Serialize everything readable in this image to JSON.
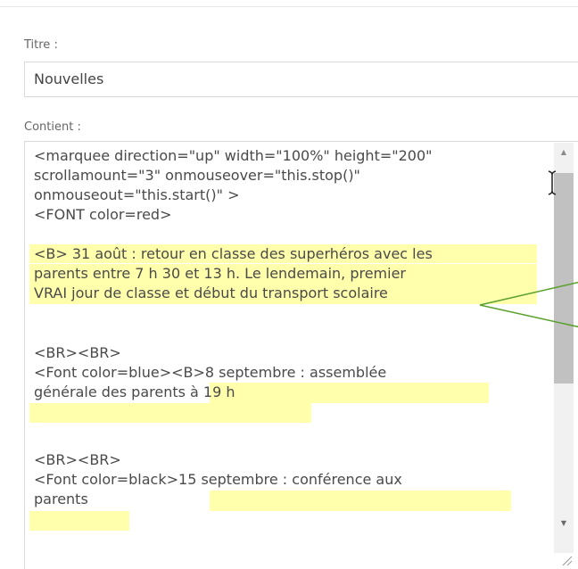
{
  "form": {
    "title_label": "Titre :",
    "title_value": "Nouvelles",
    "content_label": "Contient :"
  },
  "editor": {
    "lines": [
      "<marquee direction=\"up\" width=\"100%\"  height=\"200\"",
      "scrollamount=\"3\" onmouseover=\"this.stop()\"",
      "onmouseout=\"this.start()\" >",
      "<FONT color=red>",
      "<B> 31 août : retour en classe des superhéros avec les",
      "parents entre 7 h 30 et 13 h. Le lendemain, premier",
      "VRAI jour de classe et début du transport scolaire",
      "<BR><BR>",
      "<Font color=blue><B>8 septembre : assemblée",
      "générale des parents à 19 h",
      "<BR><BR>",
      "<Font color=black>15 septembre : conférence aux",
      "parents"
    ],
    "highlight_color": "#ffff9e"
  },
  "icons": {
    "scroll_up": "arrow-up-icon",
    "scroll_down": "arrow-down-icon",
    "resize": "resize-grip-icon",
    "cursor": "text-cursor-icon"
  },
  "annotation_color": "#5aa02c"
}
